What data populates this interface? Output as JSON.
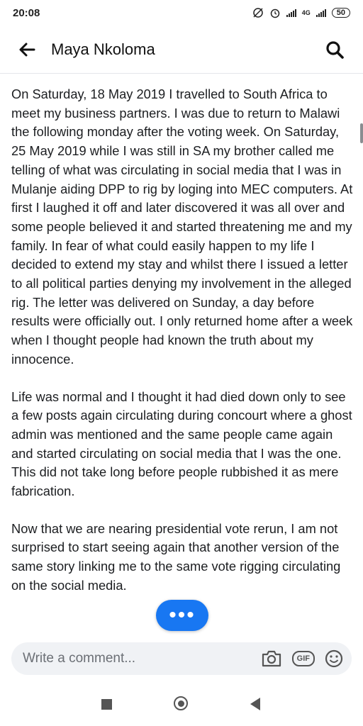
{
  "status_bar": {
    "time": "20:08",
    "network": "4G",
    "battery": "50"
  },
  "header": {
    "title": "Maya Nkoloma",
    "back_icon": "back-arrow-icon",
    "search_icon": "search-icon"
  },
  "post": {
    "paragraphs": [
      "On Saturday, 18 May 2019 I travelled to South Africa to meet my business partners. I was due to return to Malawi the following  monday after the voting week. On Saturday, 25 May 2019 while I was still in SA my brother called me telling of what was circulating in social media that I was in Mulanje aiding DPP to rig by loging into MEC computers. At first I laughed it off and later discovered it was all over and some people believed it and started threatening me and my family. In fear of what could easily happen to my life I decided to extend my stay and whilst there I issued a letter to all political parties denying my involvement in the alleged rig. The letter was delivered on Sunday, a day before results were officially out. I only returned home after a week when I thought people had known the truth about my innocence.",
      "Life was normal and I thought it had died down only to see a few posts again circulating during concourt where a ghost admin was mentioned and the same people came again and started circulating on social media that I was the one. This did not take long before people rubbished it as mere fabrication.",
      "Now that we are nearing presidential vote rerun, I am not surprised to start seeing again that another version of the same story linking me to the same vote rigging circulating on the social media."
    ]
  },
  "fab": {
    "label": "•••"
  },
  "comment_bar": {
    "placeholder": "Write a comment...",
    "gif_label": "GIF",
    "icons": [
      "camera-icon",
      "gif-icon",
      "emoji-icon"
    ]
  },
  "nav_bar": {
    "icons": [
      "recents-icon",
      "home-icon",
      "back-icon"
    ]
  }
}
